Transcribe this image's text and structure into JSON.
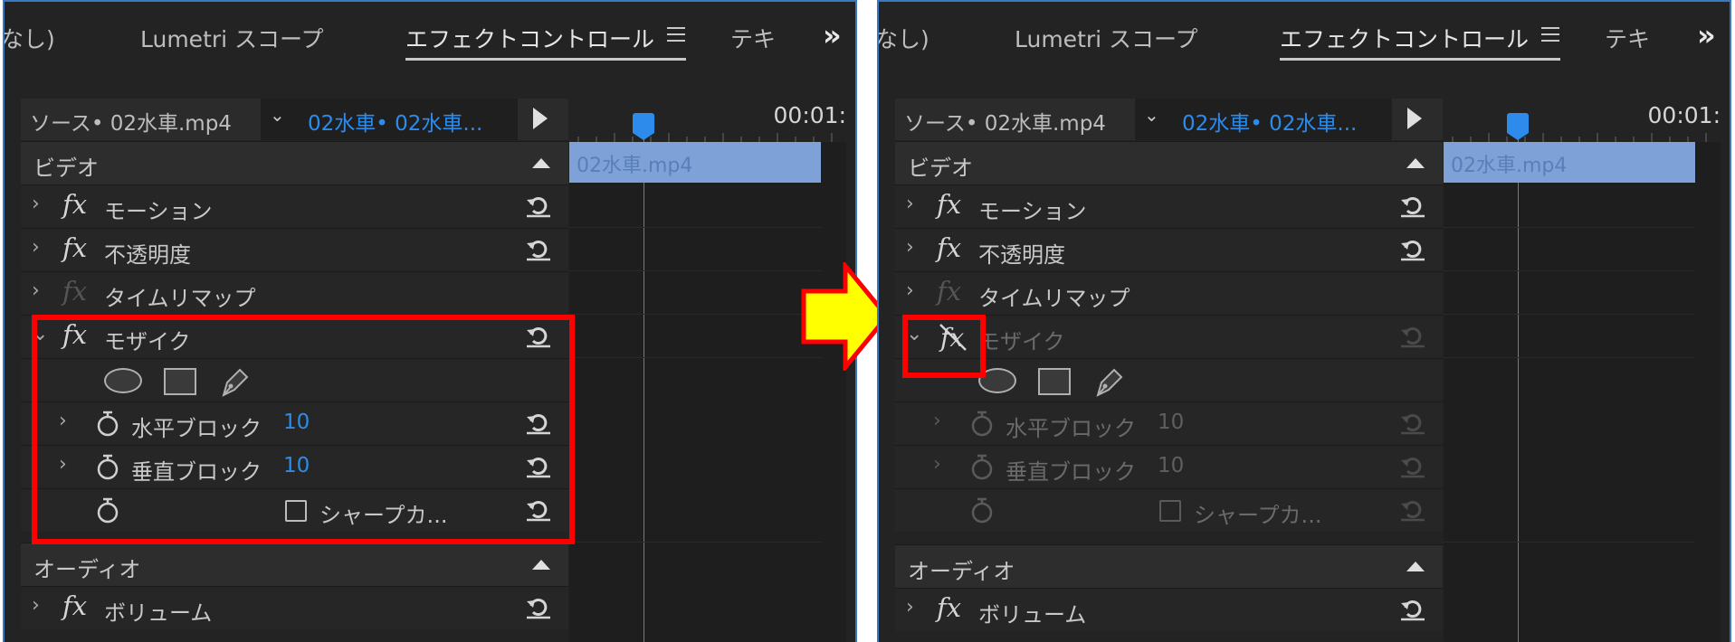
{
  "colors": {
    "accent": "#2d8ceb",
    "highlight": "#ff0000",
    "arrow_fill": "#ffff00",
    "arrow_stroke": "#ff0000",
    "clip_bar": "#7ea1d8"
  },
  "panels": [
    {
      "tabs": {
        "truncated_left": "なし)",
        "lumetri": "Lumetri スコープ",
        "effect_controls": "エフェクトコントロール",
        "truncated_right": "テキ",
        "more": "»"
      },
      "source": {
        "label": "ソース• 02水車.mp4",
        "clip": "02水車• 02水車..."
      },
      "timeline": {
        "time": "00:01:",
        "clip_name": "02水車.mp4"
      },
      "video_header": "ビデオ",
      "effects": [
        {
          "label": "モーション",
          "enabled": true
        },
        {
          "label": "不透明度",
          "enabled": true
        },
        {
          "label": "タイムリマップ",
          "enabled": false
        }
      ],
      "mosaic": {
        "label": "モザイク",
        "enabled": true,
        "fx_disabled_icon": false
      },
      "params": {
        "h_blocks_label": "水平ブロック",
        "h_blocks_value": "10",
        "v_blocks_label": "垂直ブロック",
        "v_blocks_value": "10",
        "sharp_label": "シャープカ..."
      },
      "audio_header": "オーディオ",
      "volume_label": "ボリューム"
    },
    {
      "tabs": {
        "truncated_left": "なし)",
        "lumetri": "Lumetri スコープ",
        "effect_controls": "エフェクトコントロール",
        "truncated_right": "テキ",
        "more": "»"
      },
      "source": {
        "label": "ソース• 02水車.mp4",
        "clip": "02水車• 02水車..."
      },
      "timeline": {
        "time": "00:01:",
        "clip_name": "02水車.mp4"
      },
      "video_header": "ビデオ",
      "effects": [
        {
          "label": "モーション",
          "enabled": true
        },
        {
          "label": "不透明度",
          "enabled": true
        },
        {
          "label": "タイムリマップ",
          "enabled": false
        }
      ],
      "mosaic": {
        "label": "モザイク",
        "enabled": false,
        "fx_disabled_icon": true
      },
      "params": {
        "h_blocks_label": "水平ブロック",
        "h_blocks_value": "10",
        "v_blocks_label": "垂直ブロック",
        "v_blocks_value": "10",
        "sharp_label": "シャープカ..."
      },
      "audio_header": "オーディオ",
      "volume_label": "ボリューム"
    }
  ]
}
